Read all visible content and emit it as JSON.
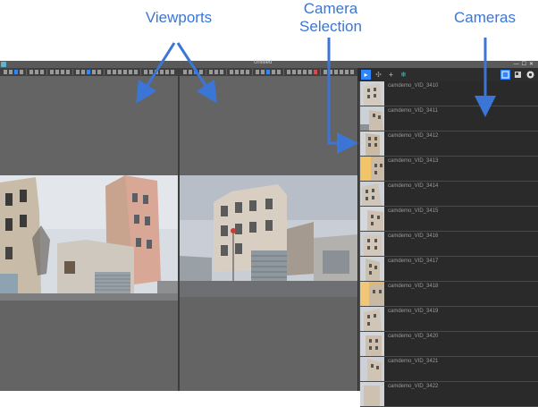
{
  "annotations": {
    "viewports": "Viewports",
    "camera_selection_line1": "Camera",
    "camera_selection_line2": "Selection",
    "cameras": "Cameras"
  },
  "window": {
    "title": "Untitled"
  },
  "colors": {
    "annotation": "#3b76d6",
    "accent_tool": "#2e87ff",
    "viewport_bg": "#646464",
    "panel_bg": "#2a2a2a"
  },
  "camera_selection": {
    "tools": [
      {
        "icon": "select-arrow-icon",
        "label": "▸",
        "active": true
      },
      {
        "icon": "move-icon",
        "label": "✣",
        "active": false
      },
      {
        "icon": "add-camera-icon",
        "label": "+",
        "active": false
      },
      {
        "icon": "snowflake-icon",
        "label": "❄",
        "active": false
      }
    ],
    "right_tools": [
      {
        "icon": "grid-view-icon",
        "active": true
      },
      {
        "icon": "square-view-icon",
        "active": false
      },
      {
        "icon": "settings-gear-icon",
        "active": false
      }
    ]
  },
  "cameras": [
    {
      "label": "camdemo_VID_3410"
    },
    {
      "label": "camdemo_VID_3411"
    },
    {
      "label": "camdemo_VID_3412"
    },
    {
      "label": "camdemo_VID_3413"
    },
    {
      "label": "camdemo_VID_3414"
    },
    {
      "label": "camdemo_VID_3415"
    },
    {
      "label": "camdemo_VID_3416"
    },
    {
      "label": "camdemo_VID_3417"
    },
    {
      "label": "camdemo_VID_3418"
    },
    {
      "label": "camdemo_VID_3419"
    },
    {
      "label": "camdemo_VID_3420"
    },
    {
      "label": "camdemo_VID_3421"
    },
    {
      "label": "camdemo_VID_3422"
    }
  ]
}
